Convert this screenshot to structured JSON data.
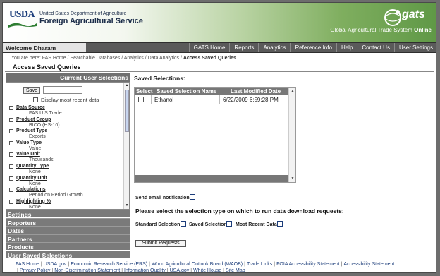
{
  "header": {
    "logo_text": "USDA",
    "department": "United States Department of Agriculture",
    "agency": "Foreign Agricultural Service",
    "gats_logo": "gats",
    "gats_tagline": "Global Agricultural Trade System",
    "gats_tagline_bold": "Online"
  },
  "nav": {
    "welcome": "Welcome Dharam",
    "items": [
      "GATS Home",
      "Reports",
      "Analytics",
      "Reference Info",
      "Help",
      "Contact Us",
      "User Settings"
    ]
  },
  "breadcrumb": {
    "prefix": "You are here:",
    "trail": [
      "FAS Home",
      "Searchable Databases",
      "Analytics",
      "Data Analytics"
    ],
    "current": "Access Saved Queries",
    "separator": "/"
  },
  "page_title": "Access Saved Queries",
  "left_panel": {
    "header": "Current User Selections",
    "save_button": "Save",
    "save_input_value": "",
    "display_recent_label": "Display most recent data",
    "selections": [
      {
        "name": "Data Source",
        "value": "FAS U.S Trade"
      },
      {
        "name": "Product Group",
        "value": "BICO (HS-10)"
      },
      {
        "name": "Product Type",
        "value": "Exports"
      },
      {
        "name": "Value Type",
        "value": "Value"
      },
      {
        "name": "Value Unit",
        "value": "Thousands"
      },
      {
        "name": "Quantity Type",
        "value": "None"
      },
      {
        "name": "Quantity Unit",
        "value": "None"
      },
      {
        "name": "Calculations",
        "value": "Period on Period Growth"
      },
      {
        "name": "Highlighting %",
        "value": "None"
      }
    ],
    "accordion": [
      "Settings",
      "Reporters",
      "Dates",
      "Partners",
      "Products",
      "User Saved Selections"
    ]
  },
  "right_panel": {
    "title": "Saved Selections:",
    "columns": [
      "Select",
      "Saved Selection Name",
      "Last Modified Date"
    ],
    "rows": [
      {
        "name": "Ethanol",
        "date": "6/22/2009 6:59:28 PM"
      }
    ],
    "email_label": "Send email notification:",
    "selection_type_label": "Please select the selection type on which to run data download requests:",
    "options": [
      "Standard Selection",
      "Saved Selection",
      "Most Recent Data"
    ],
    "submit_label": "Submit Requests"
  },
  "footer": {
    "links": [
      "FAS Home",
      "USDA.gov",
      "Economic Research Service (ERS)",
      "World Agricultural Outlook Board (WAOB)",
      "Trade Links",
      "FOIA Accessibility Statement",
      "Accessibility Statement",
      "Privacy Policy",
      "Non-Discrimination Statement",
      "Information Quality",
      "USA.gov",
      "White House",
      "Site Map"
    ]
  },
  "colors": {
    "agency_text": "#1c2d4a",
    "nav_bg": "#5a5a5a",
    "panel_header": "#707070",
    "link": "#1c3d7a"
  }
}
